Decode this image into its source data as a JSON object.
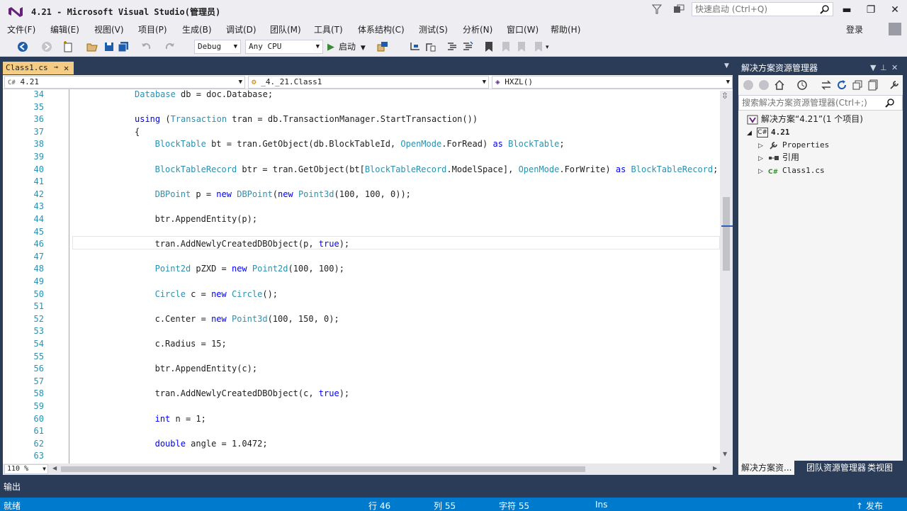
{
  "window": {
    "title": "4.21 - Microsoft Visual Studio(管理员)",
    "quick_launch_placeholder": "快速启动 (Ctrl+Q)",
    "minimize": "▬",
    "maximize": "❐",
    "close": "✕"
  },
  "menu": {
    "items": [
      "文件(F)",
      "编辑(E)",
      "视图(V)",
      "项目(P)",
      "生成(B)",
      "调试(D)",
      "团队(M)",
      "工具(T)",
      "体系结构(C)",
      "测试(S)",
      "分析(N)",
      "窗口(W)",
      "帮助(H)"
    ],
    "login": "登录"
  },
  "toolbar": {
    "config": "Debug",
    "platform": "Any CPU",
    "start": "启动"
  },
  "editor_tab": {
    "filename": "Class1.cs",
    "pin": "⊸",
    "close": "✕"
  },
  "navbar": {
    "project": "4.21",
    "type": "_4._21.Class1",
    "member": "HXZL()"
  },
  "code": {
    "line_numbers": [
      "34",
      "35",
      "36",
      "37",
      "38",
      "39",
      "40",
      "41",
      "42",
      "43",
      "44",
      "45",
      "46",
      "47",
      "48",
      "49",
      "50",
      "51",
      "52",
      "53",
      "54",
      "55",
      "56",
      "57",
      "58",
      "59",
      "60",
      "61",
      "62",
      "63"
    ],
    "lines": [
      [
        [
          "t",
          "Database"
        ],
        [
          "p",
          " db = doc.Database;"
        ]
      ],
      [],
      [
        [
          "k",
          "using"
        ],
        [
          "p",
          " ("
        ],
        [
          "t",
          "Transaction"
        ],
        [
          "p",
          " tran = db.TransactionManager.StartTransaction())"
        ]
      ],
      [
        [
          "p",
          "{"
        ]
      ],
      [
        [
          "t",
          "BlockTable"
        ],
        [
          "p",
          " bt = tran.GetObject(db.BlockTableId, "
        ],
        [
          "t",
          "OpenMode"
        ],
        [
          "p",
          ".ForRead) "
        ],
        [
          "k",
          "as"
        ],
        [
          "p",
          " "
        ],
        [
          "t",
          "BlockTable"
        ],
        [
          "p",
          ";"
        ]
      ],
      [],
      [
        [
          "t",
          "BlockTableRecord"
        ],
        [
          "p",
          " btr = tran.GetObject(bt["
        ],
        [
          "t",
          "BlockTableRecord"
        ],
        [
          "p",
          ".ModelSpace], "
        ],
        [
          "t",
          "OpenMode"
        ],
        [
          "p",
          ".ForWrite) "
        ],
        [
          "k",
          "as"
        ],
        [
          "p",
          " "
        ],
        [
          "t",
          "BlockTableRecord"
        ],
        [
          "p",
          ";"
        ]
      ],
      [],
      [
        [
          "t",
          "DBPoint"
        ],
        [
          "p",
          " p = "
        ],
        [
          "k",
          "new"
        ],
        [
          "p",
          " "
        ],
        [
          "t",
          "DBPoint"
        ],
        [
          "p",
          "("
        ],
        [
          "k",
          "new"
        ],
        [
          "p",
          " "
        ],
        [
          "t",
          "Point3d"
        ],
        [
          "p",
          "(100, 100, 0));"
        ]
      ],
      [],
      [
        [
          "p",
          "btr.AppendEntity(p);"
        ]
      ],
      [],
      [
        [
          "p",
          "tran.AddNewlyCreatedDBObject(p, "
        ],
        [
          "k",
          "true"
        ],
        [
          "p",
          ");"
        ]
      ],
      [],
      [
        [
          "t",
          "Point2d"
        ],
        [
          "p",
          " pZXD = "
        ],
        [
          "k",
          "new"
        ],
        [
          "p",
          " "
        ],
        [
          "t",
          "Point2d"
        ],
        [
          "p",
          "(100, 100);"
        ]
      ],
      [],
      [
        [
          "t",
          "Circle"
        ],
        [
          "p",
          " c = "
        ],
        [
          "k",
          "new"
        ],
        [
          "p",
          " "
        ],
        [
          "t",
          "Circle"
        ],
        [
          "p",
          "();"
        ]
      ],
      [],
      [
        [
          "p",
          "c.Center = "
        ],
        [
          "k",
          "new"
        ],
        [
          "p",
          " "
        ],
        [
          "t",
          "Point3d"
        ],
        [
          "p",
          "(100, 150, 0);"
        ]
      ],
      [],
      [
        [
          "p",
          "c.Radius = 15;"
        ]
      ],
      [],
      [
        [
          "p",
          "btr.AppendEntity(c);"
        ]
      ],
      [],
      [
        [
          "p",
          "tran.AddNewlyCreatedDBObject(c, "
        ],
        [
          "k",
          "true"
        ],
        [
          "p",
          ");"
        ]
      ],
      [],
      [
        [
          "k",
          "int"
        ],
        [
          "p",
          " n = 1;"
        ]
      ],
      [],
      [
        [
          "k",
          "double"
        ],
        [
          "p",
          " angle = 1.0472;"
        ]
      ],
      []
    ],
    "indent_levels": [
      0,
      0,
      0,
      0,
      1,
      1,
      1,
      1,
      1,
      1,
      1,
      1,
      1,
      1,
      1,
      1,
      1,
      1,
      1,
      1,
      1,
      1,
      1,
      1,
      1,
      1,
      1,
      1,
      1,
      1
    ],
    "zoom": "110 %"
  },
  "solution_explorer": {
    "title": "解决方案资源管理器",
    "search_placeholder": "搜索解决方案资源管理器(Ctrl+;)",
    "tree": {
      "solution": "解决方案“4.21”(1 个项目)",
      "project": "4.21",
      "properties": "Properties",
      "references": "引用",
      "file": "Class1.cs"
    },
    "tabs": [
      "解决方案资...",
      "团队资源管理器",
      "类视图"
    ]
  },
  "output": {
    "label": "输出"
  },
  "status": {
    "ready": "就绪",
    "line": "行 46",
    "col": "列 55",
    "ch": "字符 55",
    "mode": "Ins",
    "publish": "↑ 发布"
  },
  "colors": {
    "keyword": "#0000ff",
    "type": "#2b91af",
    "accent": "#007acc",
    "chrome": "#2b3c59"
  }
}
